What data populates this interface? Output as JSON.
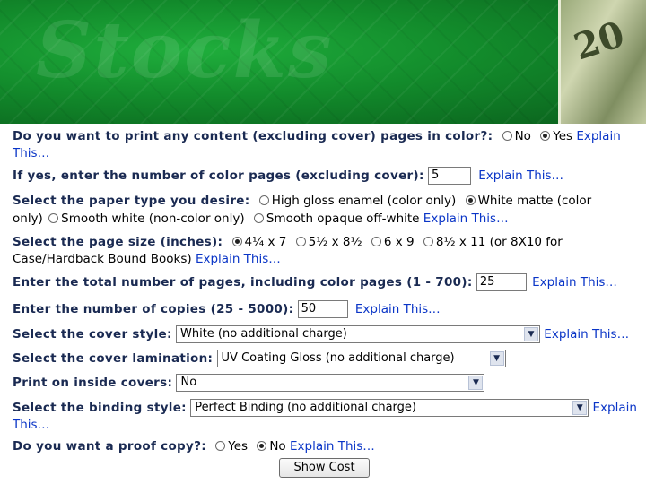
{
  "banner": {
    "watermark": "Stocks",
    "bill_number": "20"
  },
  "explain": "Explain This…",
  "explain_word": "Explain",
  "this_word": "This…",
  "color_content": {
    "label": "Do you want to print any content (excluding cover) pages in color?:",
    "options": [
      "No",
      "Yes"
    ],
    "selected": "Yes"
  },
  "color_pages": {
    "label": "If yes, enter the number of color pages (excluding cover):",
    "value": "5"
  },
  "paper_type": {
    "label": "Select the paper type you desire:",
    "options": [
      "High gloss enamel (color only)",
      "White matte (color",
      "only)",
      "Smooth white (non-color only)",
      "Smooth opaque off-white"
    ],
    "selected": "White matte (color only)"
  },
  "page_size": {
    "label": "Select the page size (inches):",
    "options": [
      "4¼ x 7",
      "5½ x 8½",
      "6 x 9",
      "8½ x 11 (or 8X10 for",
      "Case/Hardback Bound Books)"
    ],
    "selected": "4¼ x 7"
  },
  "total_pages": {
    "label": "Enter the total number of pages, including color pages (1 - 700):",
    "value": "25"
  },
  "copies": {
    "label": "Enter the number of copies (25 - 5000):",
    "value": "50"
  },
  "cover_style": {
    "label": "Select the cover style:",
    "value": "White (no additional charge)"
  },
  "cover_lamination": {
    "label": "Select the cover lamination:",
    "value": "UV Coating Gloss (no additional charge)"
  },
  "inside_covers": {
    "label": "Print on inside covers:",
    "value": "No"
  },
  "binding": {
    "label": "Select the binding style:",
    "value": "Perfect Binding (no additional charge)"
  },
  "proof": {
    "label": "Do you want a proof copy?:",
    "options": [
      "Yes",
      "No"
    ],
    "selected": "No"
  },
  "show_cost": "Show Cost"
}
